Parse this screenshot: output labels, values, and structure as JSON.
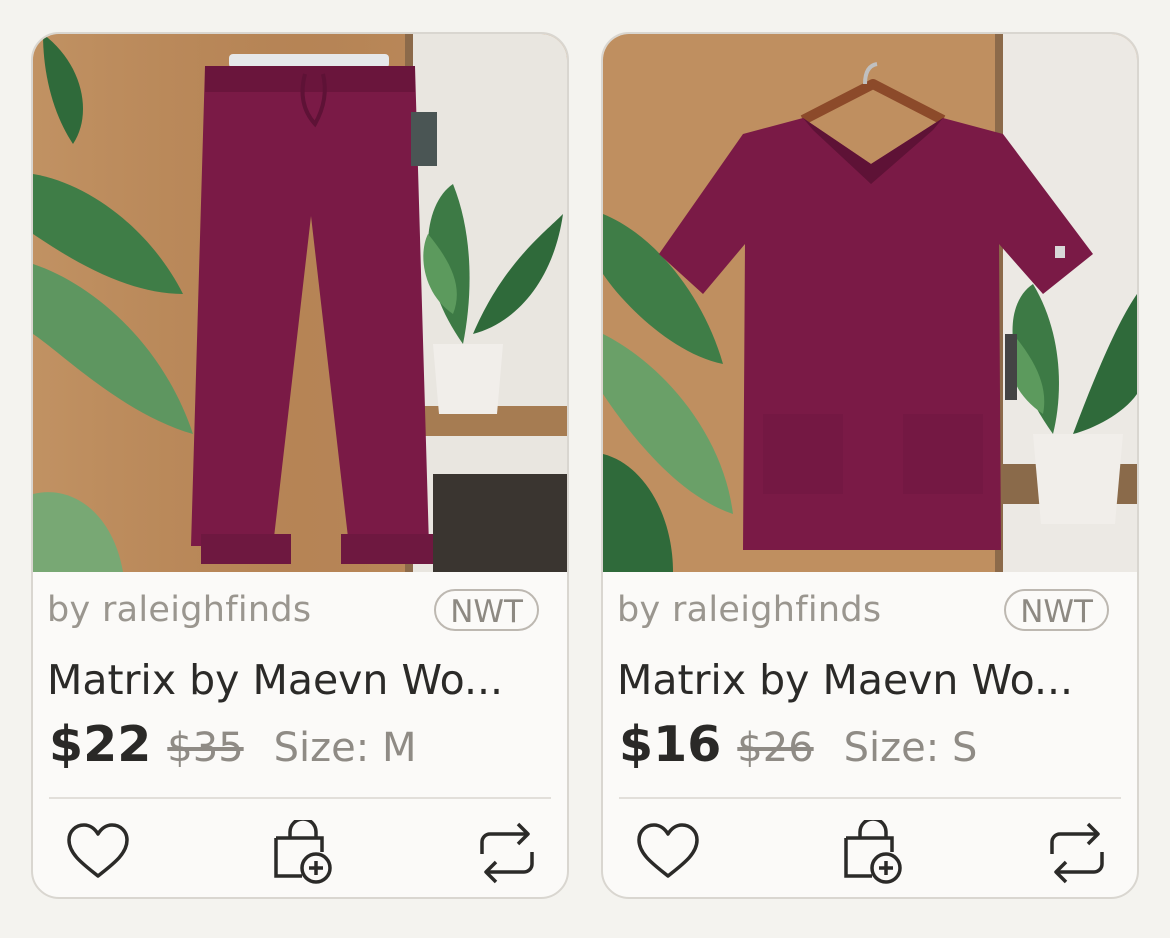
{
  "listings": [
    {
      "seller": "by raleighfinds",
      "condition": "NWT",
      "title": "Matrix by Maevn Wo...",
      "price": "$22",
      "original_price": "$35",
      "size": "Size: M",
      "garment": "burgundy scrub pants",
      "icons": [
        "heart-icon",
        "shopping-bag-add-icon",
        "share-icon"
      ]
    },
    {
      "seller": "by raleighfinds",
      "condition": "NWT",
      "title": "Matrix by Maevn Wo...",
      "price": "$16",
      "original_price": "$26",
      "size": "Size: S",
      "garment": "burgundy scrub top",
      "icons": [
        "heart-icon",
        "shopping-bag-add-icon",
        "share-icon"
      ]
    }
  ],
  "colors": {
    "garment": "#7a1a46",
    "wood": "#b8875a",
    "text_primary": "#2b2a28",
    "text_muted": "#9a968f"
  }
}
